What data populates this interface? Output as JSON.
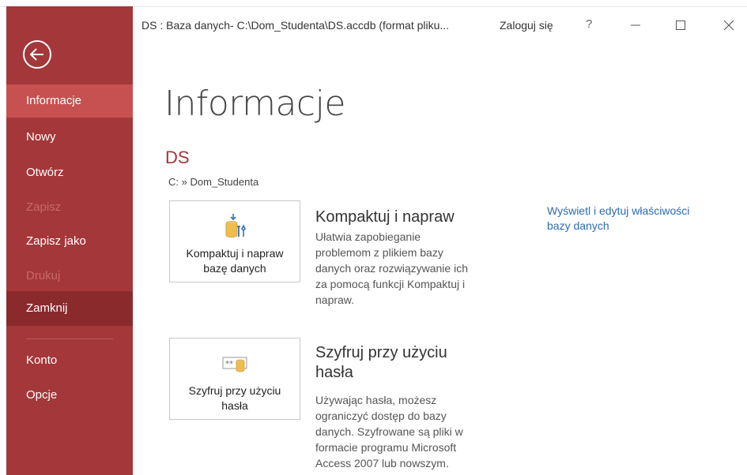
{
  "window": {
    "title": "DS : Baza danych- C:\\Dom_Studenta\\DS.accdb (format pliku...",
    "sign_in": "Zaloguj się",
    "help": "?"
  },
  "sidebar": {
    "items": [
      {
        "label": "Informacje"
      },
      {
        "label": "Nowy"
      },
      {
        "label": "Otwórz"
      },
      {
        "label": "Zapisz"
      },
      {
        "label": "Zapisz jako"
      },
      {
        "label": "Drukuj"
      },
      {
        "label": "Zamknij"
      },
      {
        "label": "Konto"
      },
      {
        "label": "Opcje"
      }
    ]
  },
  "main": {
    "title": "Informacje",
    "db_name": "DS",
    "db_path": "C: » Dom_Studenta",
    "compact": {
      "tile_line1": "Kompaktuj i napraw",
      "tile_line2": "bazę danych",
      "heading": "Kompaktuj i napraw",
      "desc_lines": [
        "Ułatwia zapobieganie",
        "problemom z plikiem bazy",
        "danych oraz rozwiązywanie ich",
        "za pomocą funkcji Kompaktuj i",
        "napraw."
      ]
    },
    "encrypt": {
      "tile_line1": "Szyfruj przy użyciu",
      "tile_line2": "hasła",
      "heading_line1": "Szyfruj przy użyciu",
      "heading_line2": "hasła",
      "desc_lines": [
        "Używając hasła, możesz",
        "ograniczyć dostęp do bazy",
        "danych. Szyfrowane są pliki w",
        "formacie programu Microsoft",
        "Access 2007 lub nowszym."
      ]
    },
    "properties_link_lines": [
      "Wyświetl i edytuj właściwości",
      "bazy danych"
    ]
  },
  "colors": {
    "sidebar": "#a4373a",
    "sidebar_selected": "#c75050",
    "sidebar_hover": "#8a2a2d",
    "accent": "#a4373a",
    "link": "#2e6ab3"
  },
  "icons": {
    "back": "back-arrow-icon",
    "minimize": "minimize-icon",
    "maximize": "maximize-icon",
    "close": "close-icon",
    "compact": "database-repair-icon",
    "encrypt": "database-lock-icon"
  }
}
